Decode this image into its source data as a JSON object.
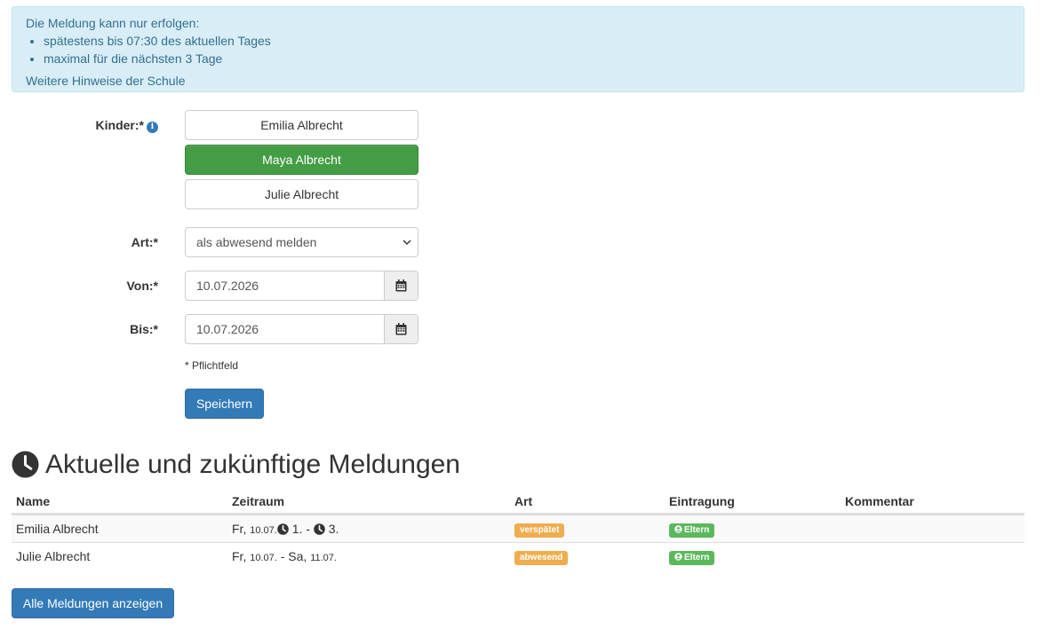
{
  "alert": {
    "intro": "Die Meldung kann nur erfolgen:",
    "rules": [
      "spätestens bis 07:30 des aktuellen Tages",
      "maximal für die nächsten 3 Tage"
    ],
    "hint_link": "Weitere Hinweise der Schule"
  },
  "form": {
    "children_label": "Kinder:*",
    "children": [
      "Emilia Albrecht",
      "Maya Albrecht",
      "Julie Albrecht"
    ],
    "selected_child": "Maya Albrecht",
    "type_label": "Art:*",
    "type_value": "als abwesend melden",
    "from_label": "Von:*",
    "from_value": "10.07.2026",
    "to_label": "Bis:*",
    "to_value": "10.07.2026",
    "required_note": "* Pflichtfeld",
    "save_label": "Speichern"
  },
  "reports": {
    "title": "Aktuelle und zukünftige Meldungen",
    "columns": [
      "Name",
      "Zeitraum",
      "Art",
      "Eintragung",
      "Kommentar"
    ],
    "rows": [
      {
        "name": "Emilia Albrecht",
        "day": "Fr,",
        "date": "10.07.",
        "lesson_from": "1.",
        "separator": "-",
        "lesson_to": "3.",
        "type": "verspätet",
        "entry": "Eltern",
        "comment": ""
      },
      {
        "name": "Julie Albrecht",
        "day": "Fr,",
        "date": "10.07.",
        "separator": "- Sa,",
        "date_to": "11.07.",
        "type": "abwesend",
        "entry": "Eltern",
        "comment": ""
      }
    ],
    "show_all_label": "Alle Meldungen anzeigen"
  },
  "colors": {
    "primary": "#337ab7",
    "active_child": "#449d44",
    "badge_warning": "#f0ad4e",
    "badge_success": "#5cb85c",
    "info_bg": "#d9edf7"
  },
  "icons": {
    "info": "info-circle-icon",
    "calendar": "calendar-icon",
    "clock": "clock-icon",
    "user": "user-circle-icon",
    "chevron": "chevron-down-icon"
  }
}
